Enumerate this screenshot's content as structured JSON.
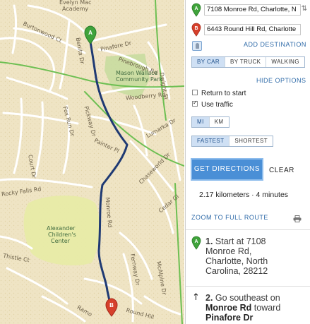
{
  "map": {
    "labels": {
      "evelyn": "Evelyn Mac",
      "academy": "Academy",
      "burtonwood": "Burtonwood Ct",
      "benita": "Benita Dr",
      "pinafore": "Pinafore Dr",
      "pinebrough": "Pinebrough Rd",
      "dwight": "Dwight St",
      "mason1": "Mason Wallace",
      "mason2": "Community Park",
      "woodberry": "Woodberry Rd",
      "fox_run": "Fox Run Dr",
      "pickway": "Pickway Dr",
      "painter": "Painter Pl",
      "lumarka": "Lumarka Dr",
      "court": "Court Dr",
      "chaseworld": "Chaseworld Dr",
      "rocky_falls": "Rocky Falls Rd",
      "cedar": "Cedar Gl",
      "monroe": "Monroe Rd",
      "alex1": "Alexander",
      "alex2": "Children's",
      "alex3": "Center",
      "thistle": "Thistle Ct",
      "fernway": "Fernway Dr",
      "mcalpine": "McAlpine Dr",
      "ramo": "Ramo",
      "round_hill": "Round Hill"
    },
    "markers": {
      "start": "A",
      "end": "B"
    }
  },
  "directions": {
    "start_address": "7108 Monroe Rd, Charlotte, N",
    "end_address": "6443 Round Hill Rd, Charlotte",
    "swap_symbol": "⇅",
    "add_destination": "ADD DESTINATION",
    "modes": [
      "BY CAR",
      "BY TRUCK",
      "WALKING"
    ],
    "selected_mode": "BY CAR",
    "hide_options": "HIDE OPTIONS",
    "return_to_start": "Return to start",
    "return_to_start_checked": false,
    "use_traffic": "Use traffic",
    "use_traffic_checked": true,
    "units": [
      "MI",
      "KM"
    ],
    "selected_unit": "MI",
    "route_types": [
      "FASTEST",
      "SHORTEST"
    ],
    "selected_route_type": "FASTEST",
    "get_directions": "GET DIRECTIONS",
    "clear": "CLEAR",
    "summary": "2.17 kilometers · 4 minutes",
    "zoom_to_full_route": "ZOOM TO FULL ROUTE",
    "steps": [
      {
        "marker": "A",
        "number": "1.",
        "text_lines": [
          "Start at 7108",
          "Monroe Rd,",
          "Charlotte, North",
          "Carolina, 28212"
        ]
      },
      {
        "marker": "↑",
        "number": "2.",
        "text_start": "Go southeast on",
        "bold_1": "Monroe Rd",
        "text_mid": "toward",
        "bold_2": "Pinafore Dr"
      }
    ]
  },
  "colors": {
    "route": "#1f3a73",
    "marker_start": "#3fa33b",
    "marker_end": "#d6402b",
    "accent": "#4a8fd6",
    "park": "#c8dca0",
    "green_road": "#6dbf52",
    "map_background": "#efe4c4"
  }
}
